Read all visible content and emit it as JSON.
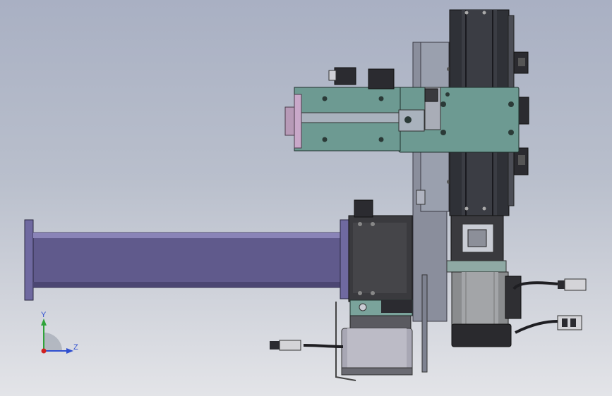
{
  "viewport": {
    "background_top": "#a9b0c3",
    "background_bottom": "#e3e4e8"
  },
  "model": {
    "colors": {
      "beam": "#605a8c",
      "plate": "#6d9a92",
      "frame": "#8a8e9c",
      "rail": "#2b2d33",
      "motor": "#3a3a3e",
      "motor_face": "#8fa9a4",
      "drum": "#a8a7b4",
      "cable": "#1e1e22"
    },
    "parts": [
      "linear-module-vertical",
      "carriage-plate",
      "slide-block-assembly",
      "servo-motor-main",
      "horizontal-beam",
      "drive-motor-housing",
      "cylinder-drum",
      "cable-connectors"
    ]
  },
  "triad": {
    "y_label": "Y",
    "z_label": "Z",
    "y_color": "#2fa33a",
    "z_color": "#2f4fd0",
    "x_color": "#d02020"
  }
}
